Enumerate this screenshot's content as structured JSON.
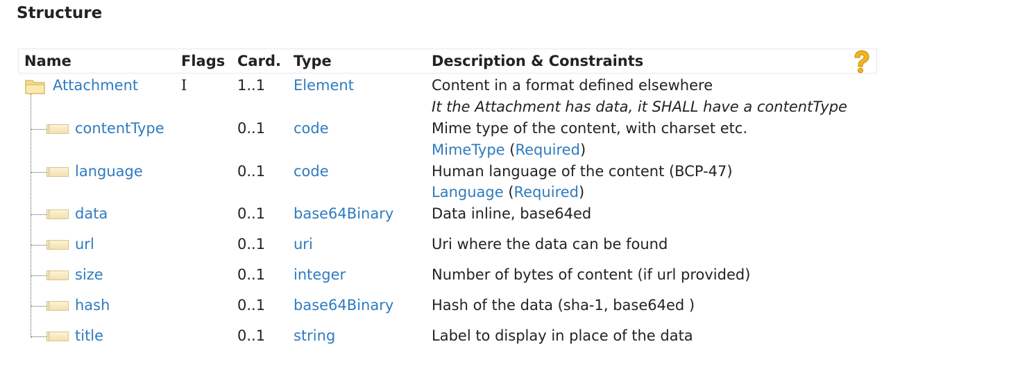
{
  "heading": "Structure",
  "columns": {
    "name": "Name",
    "flags": "Flags",
    "card": "Card.",
    "type": "Type",
    "description": "Description & Constraints"
  },
  "root": {
    "name": "Attachment",
    "flags": "I",
    "card": "1..1",
    "type": "Element",
    "description": "Content in a format defined elsewhere",
    "constraint": "It the Attachment has data, it SHALL have a contentType"
  },
  "rows": [
    {
      "name": "contentType",
      "card": "0..1",
      "type": "code",
      "description": "Mime type of the content, with charset etc.",
      "binding": "MimeType",
      "strength": "Required"
    },
    {
      "name": "language",
      "card": "0..1",
      "type": "code",
      "description": "Human language of the content (BCP-47)",
      "binding": "Language",
      "strength": "Required"
    },
    {
      "name": "data",
      "card": "0..1",
      "type": "base64Binary",
      "description": "Data inline, base64ed"
    },
    {
      "name": "url",
      "card": "0..1",
      "type": "uri",
      "description": "Uri where the data can be found"
    },
    {
      "name": "size",
      "card": "0..1",
      "type": "integer",
      "description": "Number of bytes of content (if url provided)"
    },
    {
      "name": "hash",
      "card": "0..1",
      "type": "base64Binary",
      "description": "Hash of the data (sha-1, base64ed )"
    },
    {
      "name": "title",
      "card": "0..1",
      "type": "string",
      "description": "Label to display in place of the data"
    }
  ],
  "punctuation": {
    "open": "(",
    "close": ")"
  },
  "icons": {
    "root": "folder-icon",
    "child": "element-icon",
    "help": "help-icon"
  },
  "colors": {
    "link": "#2e7bbf",
    "text": "#222222",
    "help": "#f0b41e"
  }
}
